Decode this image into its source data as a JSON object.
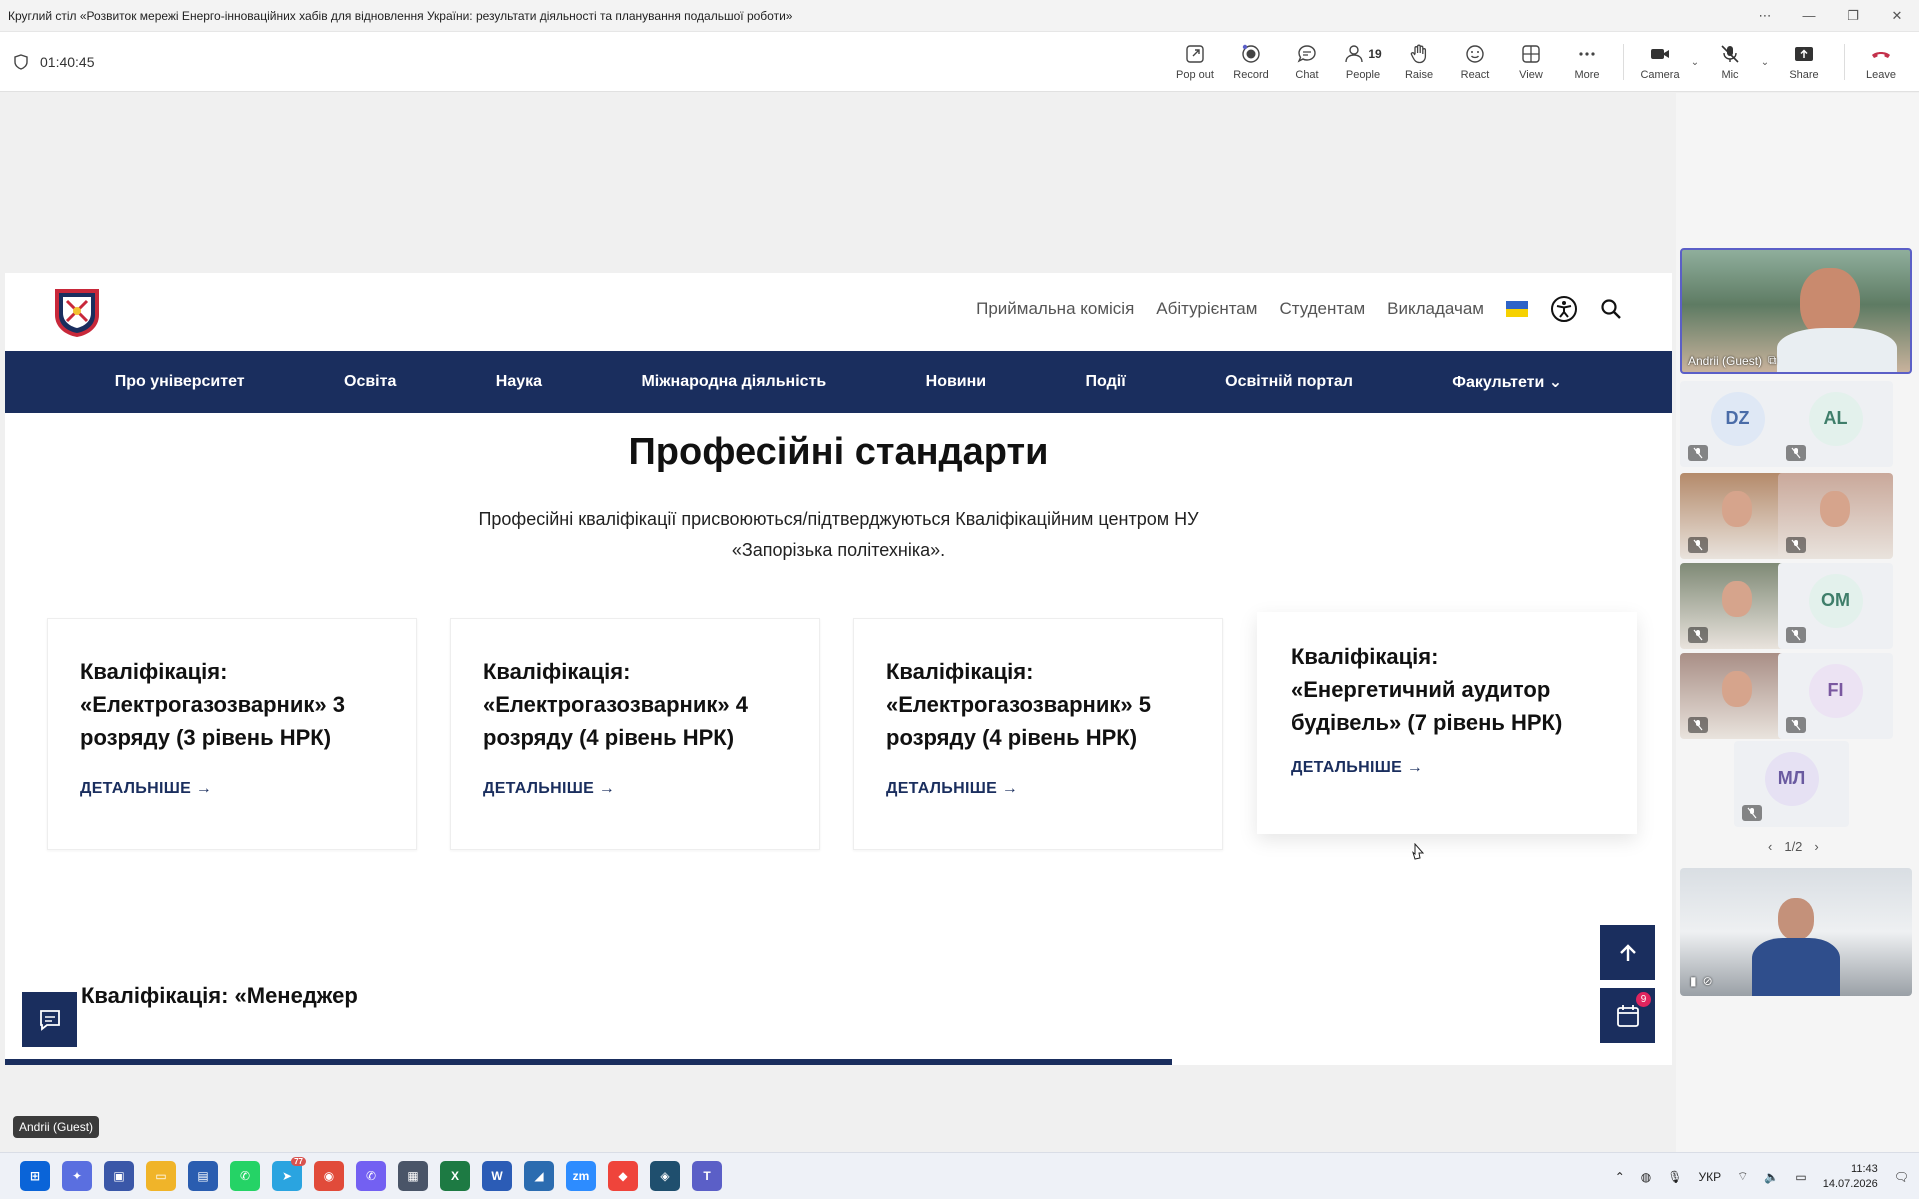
{
  "window": {
    "title": "Круглий стіл «Розвиток мережі Енерго-інноваційних хабів для відновлення України: результати діяльності та планування подальшої роботи»",
    "controls": [
      "⋯",
      "—",
      "❐",
      "✕"
    ]
  },
  "meeting": {
    "timer": "01:40:45",
    "toolbar": [
      {
        "label": "Pop out",
        "icon": "pop-out-icon"
      },
      {
        "label": "Record",
        "icon": "record-icon"
      },
      {
        "label": "Chat",
        "icon": "chat-icon"
      },
      {
        "label": "People",
        "icon": "people-icon",
        "count": "19"
      },
      {
        "label": "Raise",
        "icon": "hand-icon"
      },
      {
        "label": "React",
        "icon": "smile-icon"
      },
      {
        "label": "View",
        "icon": "grid-icon"
      },
      {
        "label": "More",
        "icon": "more-icon"
      },
      {
        "label": "Camera",
        "icon": "camera-icon"
      },
      {
        "label": "Mic",
        "icon": "mic-off-icon"
      },
      {
        "label": "Share",
        "icon": "share-icon"
      },
      {
        "label": "Leave",
        "icon": "phone-hangup-icon"
      }
    ],
    "presenter_name": "Andrii (Guest)"
  },
  "site": {
    "topnav": [
      "Приймальна комісія",
      "Абітурієнтам",
      "Студентам",
      "Викладачам"
    ],
    "mainnav": [
      "Про університет",
      "Освіта",
      "Наука",
      "Міжнародна діяльність",
      "Новини",
      "Події",
      "Освітній портал",
      "Факультети"
    ],
    "heading": "Професійні стандарти",
    "intro": "Професійні кваліфікації присвоюються/підтверджуються Кваліфікаційним центром НУ «Запорізька політехніка».",
    "cards": [
      {
        "title": "Кваліфікація: «Електрогазозварник» 3 розряду (3 рівень НРК)",
        "link": "ДЕТАЛЬНІШЕ →"
      },
      {
        "title": "Кваліфікація: «Електрогазозварник» 4 розряду (4 рівень НРК)",
        "link": "ДЕТАЛЬНІШЕ →"
      },
      {
        "title": "Кваліфікація: «Електрогазозварник» 5 розряду (4 рівень НРК)",
        "link": "ДЕТАЛЬНІШЕ →"
      },
      {
        "title": "Кваліфікація: «Енергетичний аудитор будівель» (7 рівень НРК)",
        "link": "ДЕТАЛЬНІШЕ →"
      }
    ],
    "next_heading": "Кваліфікація: «Менеджер",
    "calendar_badge": "9",
    "scroll_progress": 0.7
  },
  "participants": {
    "featured": {
      "name": "Andrii (Guest)"
    },
    "tiles": [
      {
        "initials": "DZ",
        "avatar_color": "#dfe8f5",
        "text_color": "#4a6ca8"
      },
      {
        "initials": "AL",
        "avatar_color": "#e3f1ec",
        "text_color": "#3f7e6a"
      },
      {
        "initials": "",
        "video": true,
        "color": "#b48a6a"
      },
      {
        "initials": "",
        "video": true,
        "color": "#c9a89a"
      },
      {
        "initials": "",
        "video": true,
        "color": "#7f8a76"
      },
      {
        "initials": "OM",
        "avatar_color": "#e3f1ec",
        "text_color": "#3f7e6a"
      },
      {
        "initials": "",
        "video": true,
        "color": "#a98f86"
      },
      {
        "initials": "FI",
        "avatar_color": "#ece3f3",
        "text_color": "#7a58a0"
      },
      {
        "initials": "МЛ",
        "avatar_color": "#e6e1f3",
        "text_color": "#6a5aa0"
      }
    ],
    "pager": "1/2"
  },
  "taskbar": {
    "apps": [
      {
        "name": "windows-start",
        "color": "#0a64d8",
        "glyph": "⊞"
      },
      {
        "name": "copilot",
        "color": "#5a6fe0",
        "glyph": "✦"
      },
      {
        "name": "app",
        "color": "#3a57a8",
        "glyph": "▣"
      },
      {
        "name": "explorer",
        "color": "#f0b429",
        "glyph": "▭"
      },
      {
        "name": "save",
        "color": "#2a5db0",
        "glyph": "▤"
      },
      {
        "name": "whatsapp",
        "color": "#25d366",
        "glyph": "✆"
      },
      {
        "name": "telegram",
        "color": "#2aa4e0",
        "glyph": "➤",
        "count": "77"
      },
      {
        "name": "chrome",
        "color": "#e14b3a",
        "glyph": "◉"
      },
      {
        "name": "viber",
        "color": "#7360f2",
        "glyph": "✆"
      },
      {
        "name": "calculator",
        "color": "#4a5568",
        "glyph": "▦"
      },
      {
        "name": "excel",
        "color": "#1d7a43",
        "glyph": "X"
      },
      {
        "name": "word",
        "color": "#2b5cb6",
        "glyph": "W"
      },
      {
        "name": "app2",
        "color": "#2b6cb0",
        "glyph": "◢"
      },
      {
        "name": "zoom",
        "color": "#2d8cff",
        "glyph": "zm"
      },
      {
        "name": "anydesk",
        "color": "#ef443b",
        "glyph": "◆"
      },
      {
        "name": "app3",
        "color": "#1f4f6e",
        "glyph": "◈"
      },
      {
        "name": "teams",
        "color": "#5b5fc7",
        "glyph": "T"
      }
    ],
    "lang": "УКР",
    "time": "11:43",
    "date": "14.07.2026"
  }
}
